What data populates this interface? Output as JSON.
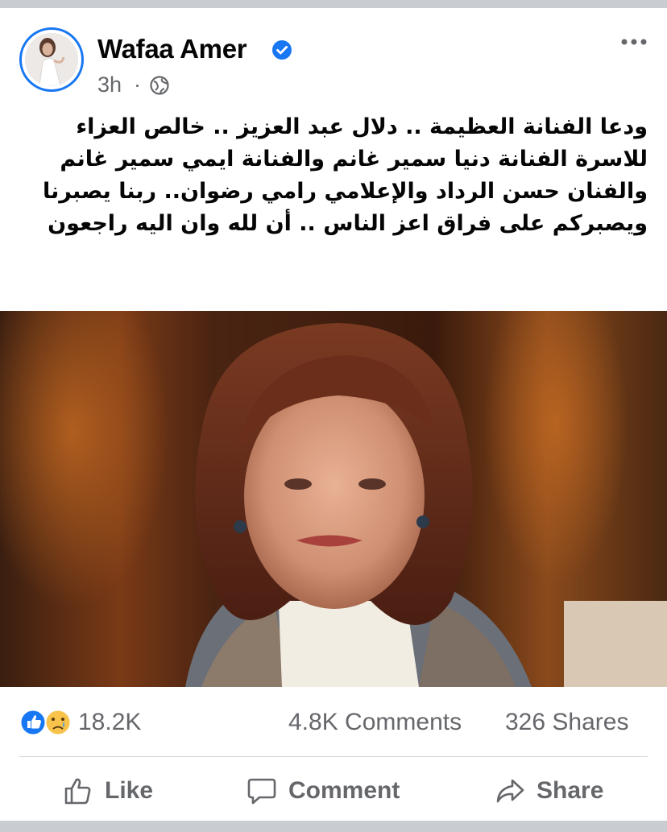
{
  "post": {
    "author": "Wafaa Amer",
    "time": "3h",
    "separator": "·",
    "privacy_icon": "globe-icon",
    "verified_icon": "verified-badge-icon",
    "more_icon": "more-options-icon",
    "text": "ودعا الفنانة العظيمة .. دلال عبد العزيز .. خالص العزاء للاسرة الفنانة دنيا سمير غانم والفنانة ايمي سمير غانم والفنان حسن الرداد والإعلامي رامي رضوان.. ربنا يصبرنا ويصبركم على فراق اعز الناس .. أن لله وان اليه راجعون"
  },
  "stats": {
    "reaction_icons": [
      "like-reaction-icon",
      "sad-reaction-icon"
    ],
    "reactions": "18.2K",
    "comments": "4.8K Comments",
    "shares": "326 Shares"
  },
  "actions": {
    "like": "Like",
    "comment": "Comment",
    "share": "Share"
  },
  "colors": {
    "brand_blue": "#1877f2",
    "secondary_text": "#65676b",
    "primary_text": "#050505",
    "divider": "#ced0d4"
  }
}
